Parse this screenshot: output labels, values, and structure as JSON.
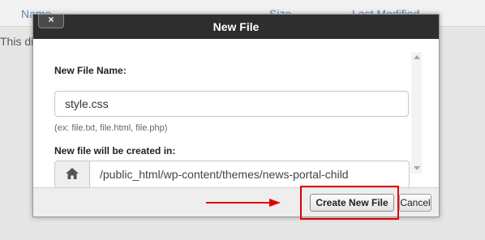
{
  "background": {
    "columns": [
      "Name",
      "Size",
      "Last Modified"
    ],
    "note": "This di"
  },
  "dialog": {
    "title": "New File",
    "close_label": "×",
    "name_label": "New File Name:",
    "name_value": "style.css",
    "name_hint": "(ex: file.txt, file.html, file.php)",
    "path_label": "New file will be created in:",
    "path_icon": "home-icon",
    "path_value": "/public_html/wp-content/themes/news-portal-child",
    "create_label": "Create New File",
    "cancel_label": "Cancel"
  },
  "annotation": {
    "highlight_color": "#e00000",
    "arrow_color": "#e00000"
  }
}
